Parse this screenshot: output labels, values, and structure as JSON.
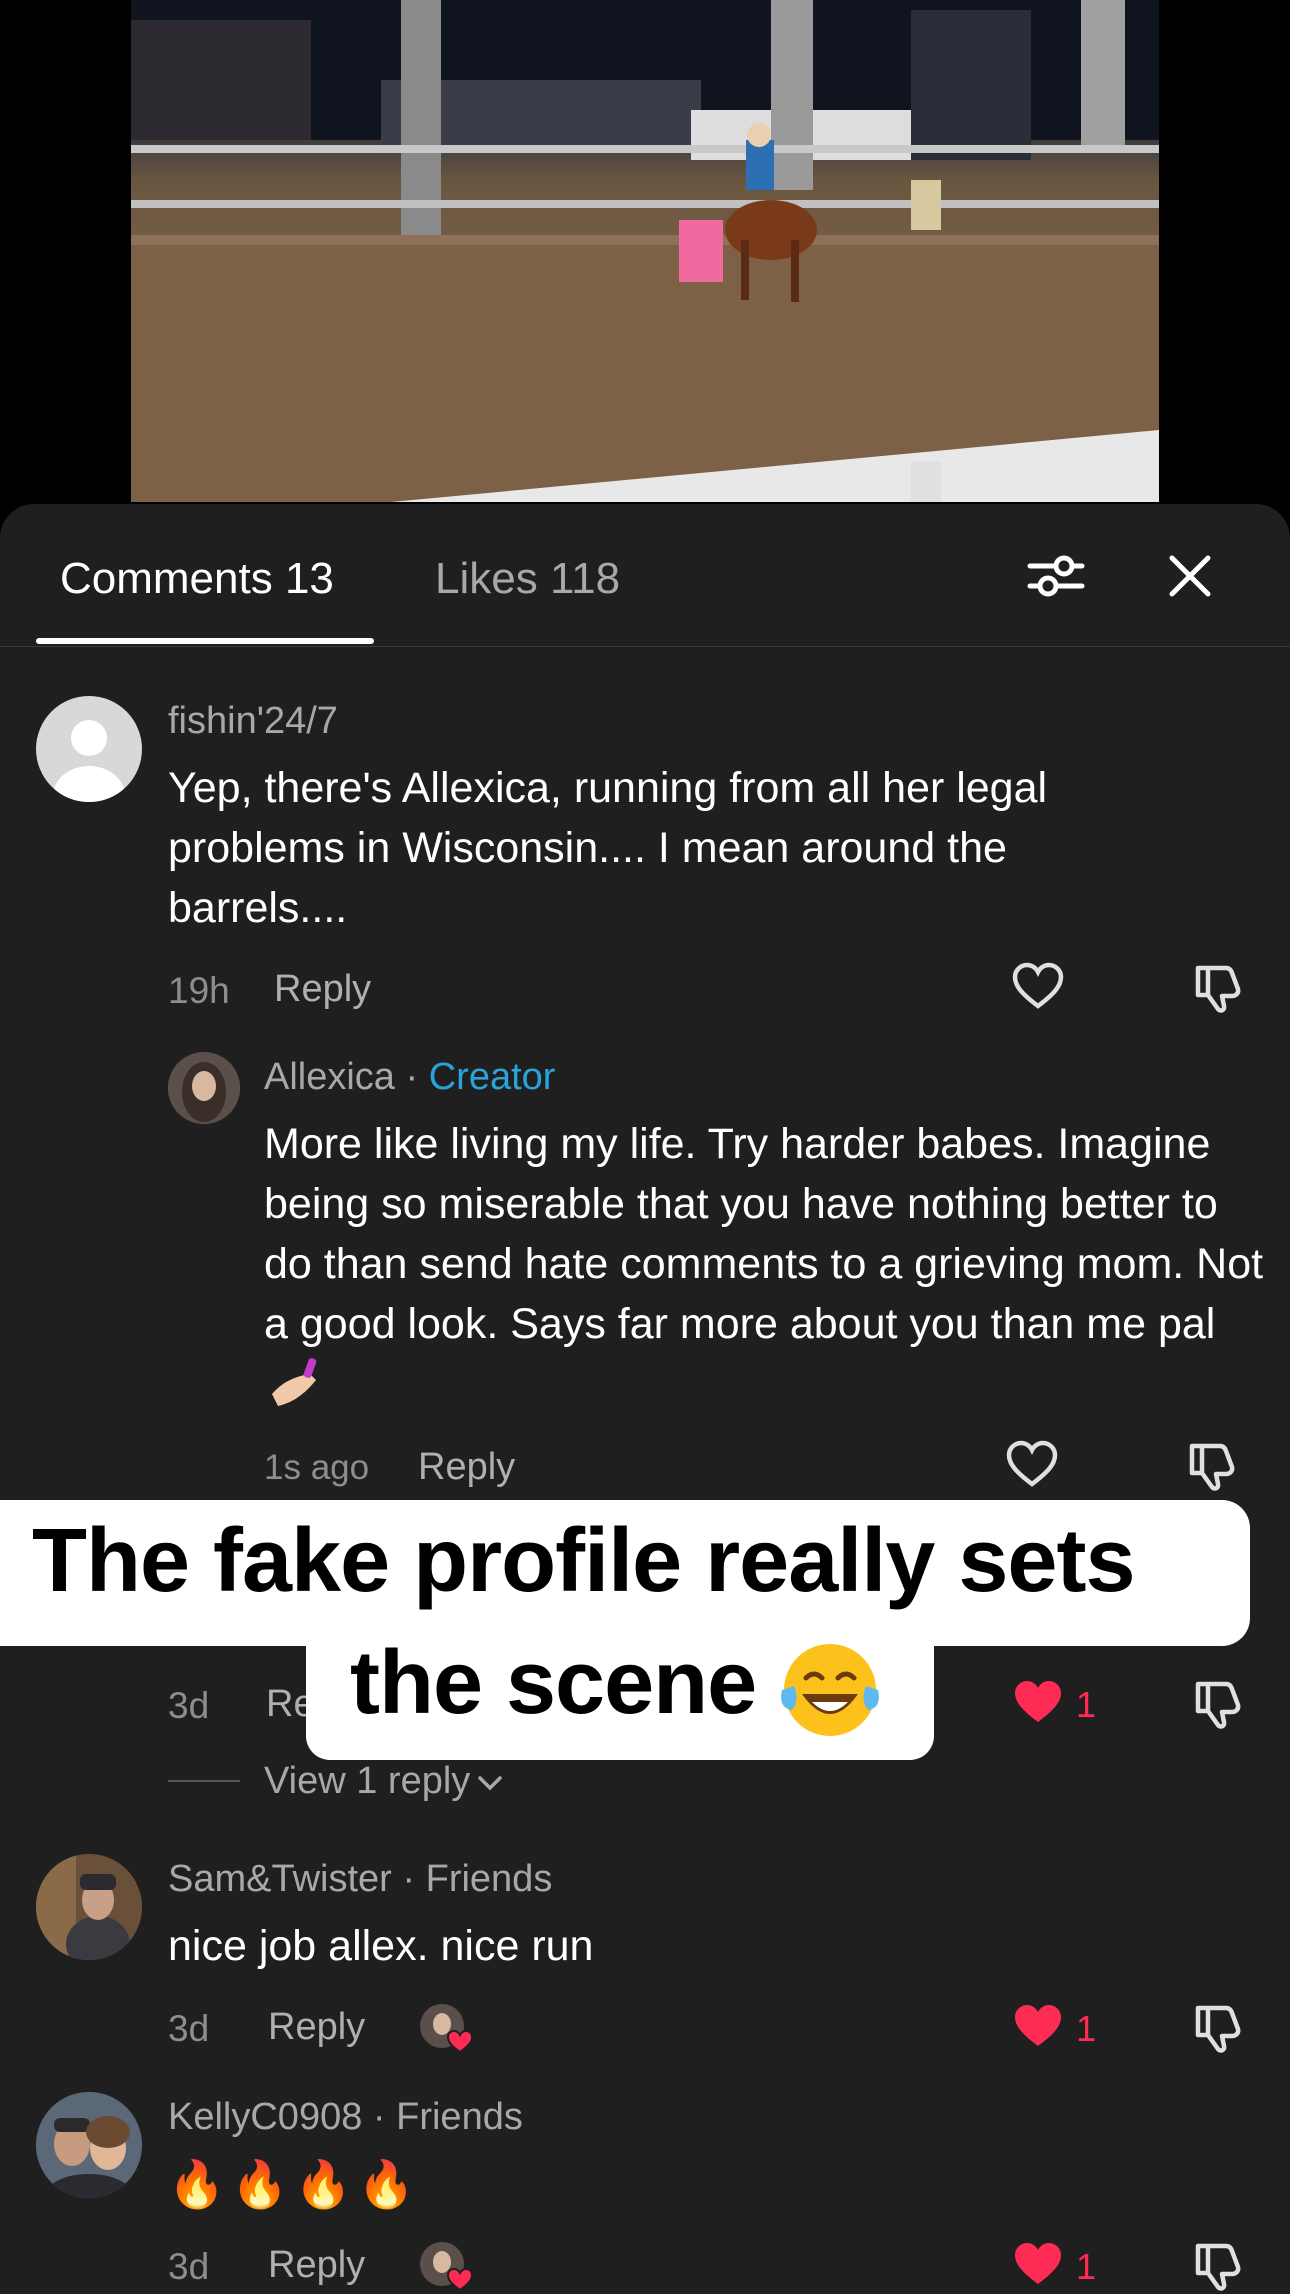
{
  "tabs": {
    "comments_label": "Comments 13",
    "likes_label": "Likes 118"
  },
  "comments": [
    {
      "username": "fishin'24/7",
      "text": "Yep, there's Allexica, running from all her legal problems in Wisconsin.... I mean around the barrels....",
      "time": "19h",
      "reply_label": "Reply"
    },
    {
      "username": "Allexica",
      "badge": "Creator",
      "separator": " · ",
      "text": "More like living my life. Try harder babes. Imagine being so miserable that you have nothing better to do than send hate comments to a grieving mom. Not a good look. Says far more about you than me pal",
      "time": "1s ago",
      "reply_label": "Reply"
    },
    {
      "time": "3d",
      "reply_label_partial": "Re",
      "likes": "1",
      "view_replies": "View 1 reply"
    },
    {
      "username": "Sam&Twister",
      "badge": "Friends",
      "separator": " · ",
      "text": "nice job allex. nice run",
      "time": "3d",
      "reply_label": "Reply",
      "likes": "1"
    },
    {
      "username": "KellyC0908",
      "badge": "Friends",
      "separator": " · ",
      "text": "🔥🔥🔥🔥",
      "time": "3d",
      "reply_label": "Reply",
      "likes": "1"
    }
  ],
  "overlay": {
    "line1": "The fake profile really sets",
    "line2": "the scene"
  },
  "colors": {
    "sheet_bg": "#1f1f1f",
    "creator_blue": "#2aa3d8",
    "like_red": "#fe2c55"
  }
}
